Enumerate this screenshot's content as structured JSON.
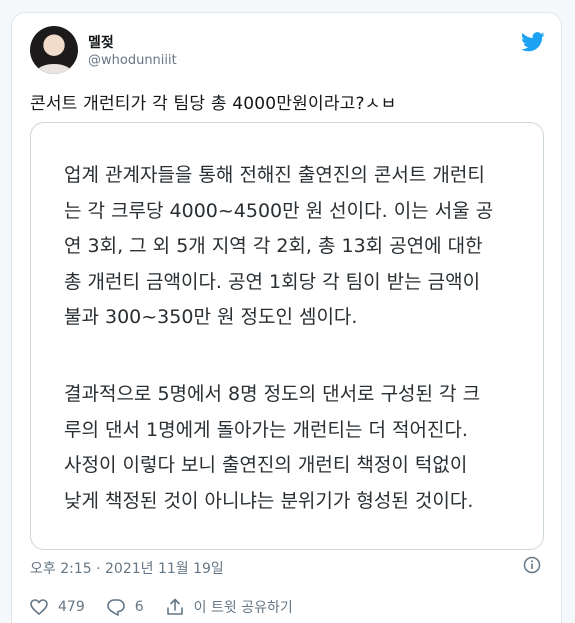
{
  "author": {
    "name": "멜젖",
    "handle": "@whodunniiit"
  },
  "tweet": {
    "text": "콘서트 개런티가 각 팀당 총 4000만원이라고?ㅅㅂ"
  },
  "quoted_image": {
    "paragraph1": [
      "업계 관계자들을 통해 전해진 출연진의 콘서트 개런티",
      "는 각 크루당 4000~4500만 원 선이다. 이는 서울 공",
      "연 3회, 그 외 5개 지역 각 2회, 총 13회 공연에 대한",
      "총 개런티 금액이다. 공연 1회당 각 팀이 받는 금액이",
      "불과 300~350만 원 정도인 셈이다."
    ],
    "paragraph2": [
      "결과적으로 5명에서 8명 정도의 댄서로 구성된 각 크",
      "루의 댄서 1명에게 돌아가는 개런티는 더 적어진다.",
      "사정이 이렇다 보니 출연진의 개런티 책정이 턱없이",
      "낮게 책정된 것이 아니냐는 분위기가 형성된 것이다."
    ]
  },
  "meta": {
    "timestamp": "오후 2:15 · 2021년 11월 19일"
  },
  "actions": {
    "like_count": "479",
    "reply_count": "6",
    "share_label": "이 트윗 공유하기"
  },
  "colors": {
    "accent": "#1da1f2",
    "text": "#14171a",
    "secondary": "#657786",
    "border": "#ccd6dd"
  },
  "icons": [
    "twitter-bird-icon",
    "info-icon",
    "heart-icon",
    "reply-icon",
    "share-icon"
  ]
}
